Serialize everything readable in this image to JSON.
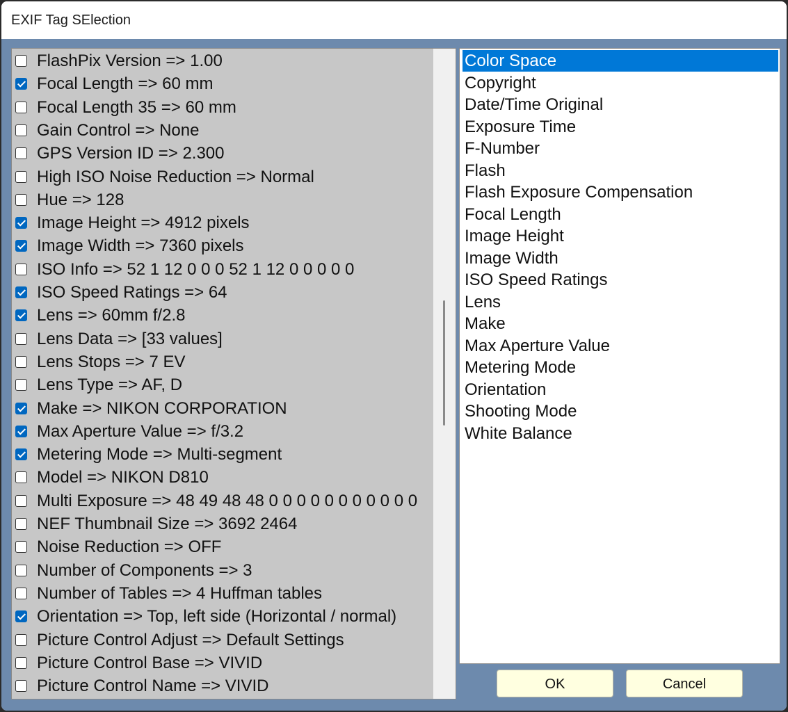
{
  "window": {
    "title": "EXIF Tag SElection"
  },
  "tags_list": {
    "items": [
      {
        "label": "FlashPix Version => 1.00",
        "checked": false
      },
      {
        "label": "Focal Length => 60 mm",
        "checked": true
      },
      {
        "label": "Focal Length 35 => 60 mm",
        "checked": false
      },
      {
        "label": "Gain Control => None",
        "checked": false
      },
      {
        "label": "GPS Version ID => 2.300",
        "checked": false
      },
      {
        "label": "High ISO Noise Reduction => Normal",
        "checked": false
      },
      {
        "label": "Hue => 128",
        "checked": false
      },
      {
        "label": "Image Height => 4912 pixels",
        "checked": true
      },
      {
        "label": "Image Width => 7360 pixels",
        "checked": true
      },
      {
        "label": "ISO Info => 52 1 12 0 0 0 52 1 12 0 0 0 0 0",
        "checked": false
      },
      {
        "label": "ISO Speed Ratings => 64",
        "checked": true
      },
      {
        "label": "Lens => 60mm f/2.8",
        "checked": true
      },
      {
        "label": "Lens Data => [33 values]",
        "checked": false
      },
      {
        "label": "Lens Stops => 7 EV",
        "checked": false
      },
      {
        "label": "Lens Type => AF, D",
        "checked": false
      },
      {
        "label": "Make => NIKON CORPORATION",
        "checked": true
      },
      {
        "label": "Max Aperture Value => f/3.2",
        "checked": true
      },
      {
        "label": "Metering Mode => Multi-segment",
        "checked": true
      },
      {
        "label": "Model => NIKON D810",
        "checked": false
      },
      {
        "label": "Multi Exposure => 48 49 48 48 0 0 0 0 0 0 0 0 0 0 0",
        "checked": false
      },
      {
        "label": "NEF Thumbnail Size => 3692 2464",
        "checked": false
      },
      {
        "label": "Noise Reduction => OFF",
        "checked": false
      },
      {
        "label": "Number of Components => 3",
        "checked": false
      },
      {
        "label": "Number of Tables => 4 Huffman tables",
        "checked": false
      },
      {
        "label": "Orientation => Top, left side (Horizontal / normal)",
        "checked": true
      },
      {
        "label": "Picture Control Adjust => Default Settings",
        "checked": false
      },
      {
        "label": "Picture Control Base => VIVID",
        "checked": false
      },
      {
        "label": "Picture Control Name => VIVID",
        "checked": false
      }
    ]
  },
  "selected_list": {
    "selected_index": 0,
    "items": [
      "Color Space",
      "Copyright",
      "Date/Time Original",
      "Exposure Time",
      "F-Number",
      "Flash",
      "Flash Exposure Compensation",
      "Focal Length",
      "Image Height",
      "Image Width",
      "ISO Speed Ratings",
      "Lens",
      "Make",
      "Max Aperture Value",
      "Metering Mode",
      "Orientation",
      "Shooting Mode",
      "White Balance"
    ]
  },
  "buttons": {
    "ok": "OK",
    "cancel": "Cancel"
  },
  "colors": {
    "client_bg": "#6d8aad",
    "list_bg": "#c7c7c7",
    "selection": "#0078d7",
    "checkbox_checked": "#0067c0",
    "button_bg": "#ffffe0"
  }
}
